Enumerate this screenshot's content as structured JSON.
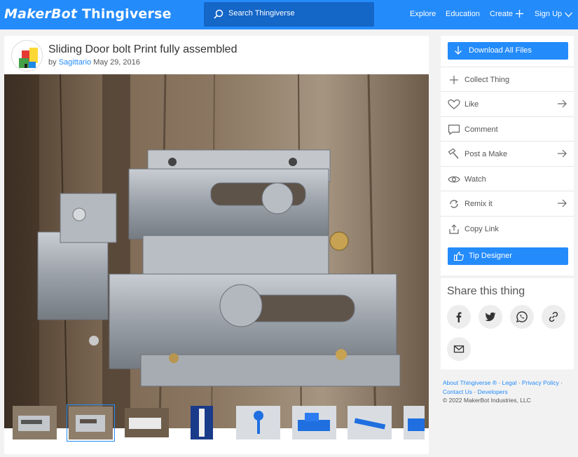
{
  "header": {
    "brand_left": "MakerBot",
    "brand_right": "Thingiverse",
    "search_placeholder": "Search Thingiverse",
    "nav": {
      "explore": "Explore",
      "education": "Education",
      "create": "Create",
      "signup": "Sign Up"
    }
  },
  "thing": {
    "title": "Sliding Door bolt Print fully assembled",
    "by": "by",
    "author": "Sagittario",
    "date": "May 29, 2016"
  },
  "actions": {
    "download": "Download All Files",
    "collect": "Collect Thing",
    "like": "Like",
    "comment": "Comment",
    "post_make": "Post a Make",
    "watch": "Watch",
    "remix": "Remix it",
    "copy_link": "Copy Link",
    "tip": "Tip Designer"
  },
  "share": {
    "title": "Share this thing",
    "icons": [
      "facebook-icon",
      "twitter-icon",
      "whatsapp-icon",
      "link-icon",
      "email-icon"
    ]
  },
  "footer": {
    "about": "About Thingiverse ®",
    "legal": "Legal",
    "privacy": "Privacy Policy",
    "contact": "Contact Us",
    "developers": "Developers",
    "copyright": "© 2022 MakerBot Industries, LLC"
  },
  "colors": {
    "accent": "#248bfb",
    "search_bg": "#1466c7",
    "page_bg": "#f2f2f2"
  }
}
